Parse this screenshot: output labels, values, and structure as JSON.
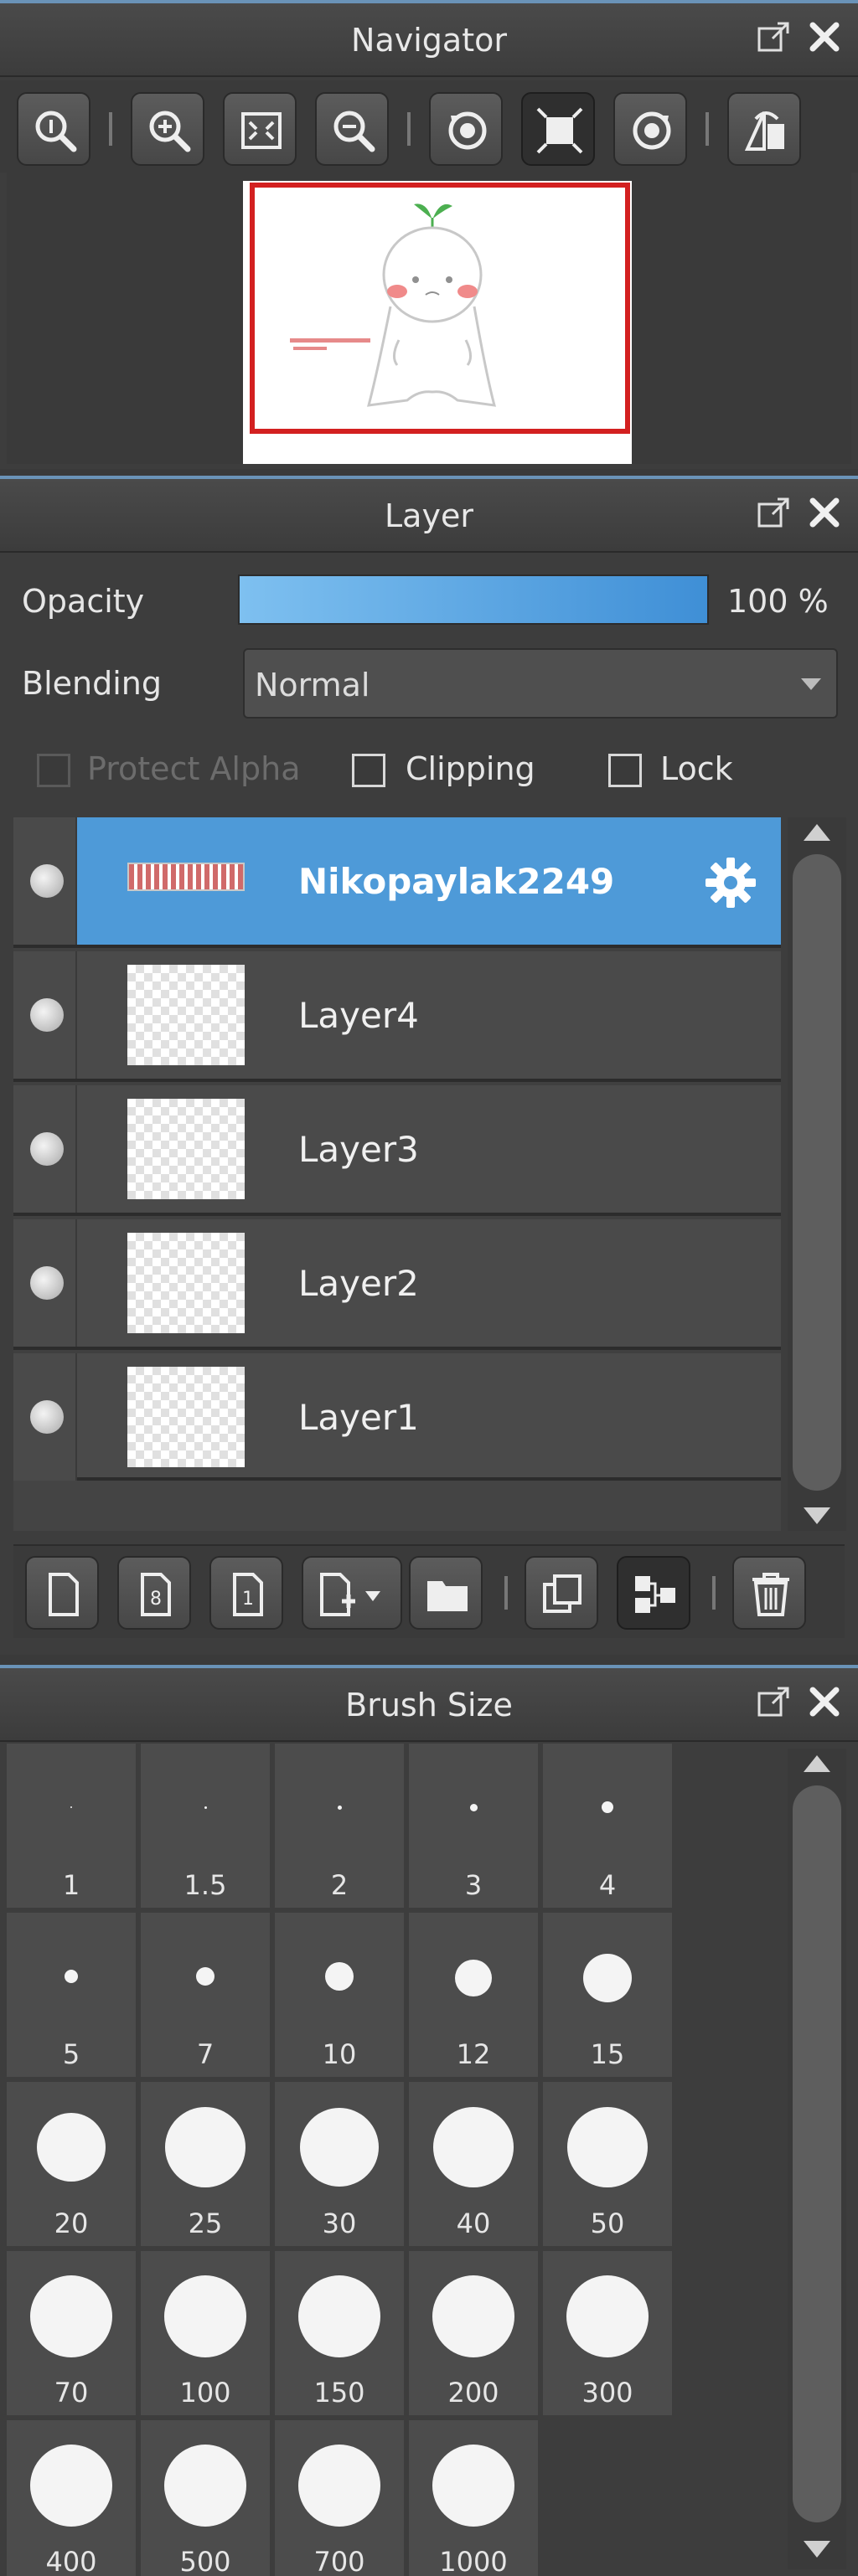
{
  "navigator": {
    "title": "Navigator",
    "toolbar": [
      "zoom-reset-icon",
      "zoom-in-icon",
      "fit-window-icon",
      "zoom-out-icon",
      "rotate-left-icon",
      "actual-size-icon",
      "rotate-right-icon",
      "flip-horizontal-icon"
    ]
  },
  "layer": {
    "title": "Layer",
    "opacity_label": "Opacity",
    "opacity_value": "100 %",
    "opacity_fraction": 1.0,
    "blending_label": "Blending",
    "blending_value": "Normal",
    "protect_alpha_label": "Protect Alpha",
    "clipping_label": "Clipping",
    "lock_label": "Lock",
    "layers": [
      {
        "name": "Nikopaylak2249",
        "selected": true
      },
      {
        "name": "Layer4",
        "selected": false
      },
      {
        "name": "Layer3",
        "selected": false
      },
      {
        "name": "Layer2",
        "selected": false
      },
      {
        "name": "Layer1",
        "selected": false
      }
    ],
    "toolbar": [
      "new-layer-icon",
      "new-8bit-layer-icon",
      "new-1bit-layer-icon",
      "add-layer-menu-icon",
      "new-folder-icon",
      "duplicate-layer-icon",
      "merge-down-icon",
      "delete-layer-icon"
    ]
  },
  "brush": {
    "title": "Brush Size",
    "sizes": [
      "1",
      "1.5",
      "2",
      "3",
      "4",
      "5",
      "7",
      "10",
      "12",
      "15",
      "20",
      "25",
      "30",
      "40",
      "50",
      "70",
      "100",
      "150",
      "200",
      "300",
      "400",
      "500",
      "700",
      "1000"
    ]
  },
  "colors": {
    "accent": "#4e9ad8",
    "panel_bg": "#3d3d3d",
    "selection_frame": "#d32020"
  }
}
